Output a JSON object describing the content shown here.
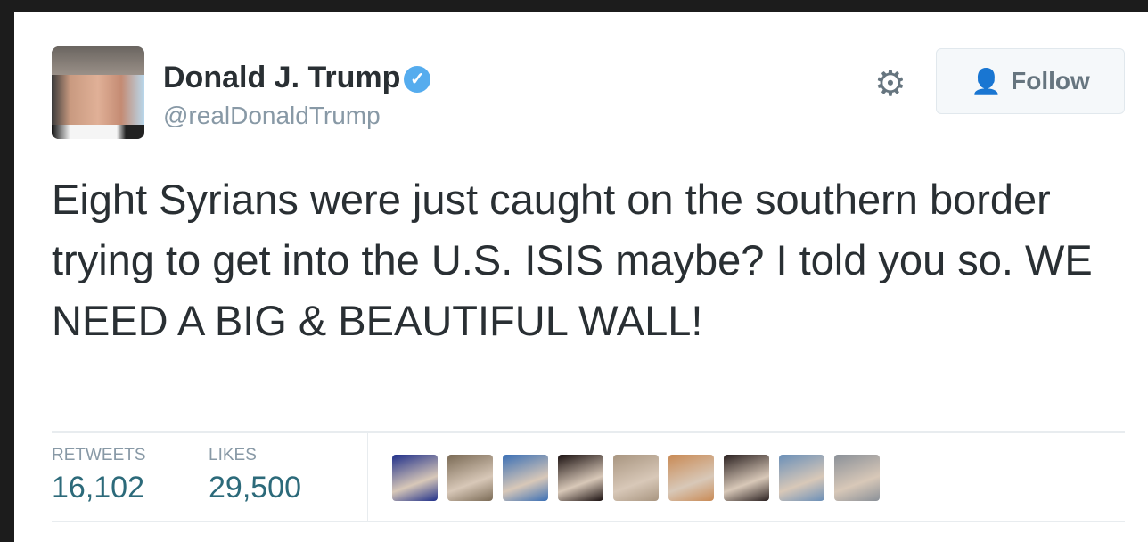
{
  "tweet": {
    "author_name": "Donald J. Trump",
    "handle": "@realDonaldTrump",
    "verified_icon": "verified-badge-icon",
    "follow_label": "Follow",
    "text": "Eight Syrians were just caught on the southern border trying to get into the U.S. ISIS maybe? I told you so. WE NEED A BIG & BEAUTIFUL WALL!",
    "stats": [
      {
        "label": "RETWEETS",
        "value": "16,102"
      },
      {
        "label": "LIKES",
        "value": "29,500"
      }
    ],
    "liker_avatar_colors": [
      "#1f2f8a",
      "#7a6a55",
      "#3a6fb5",
      "#1a1010",
      "#a89580",
      "#c98a55",
      "#2a2020",
      "#6a8fb8",
      "#8a9098"
    ]
  },
  "colors": {
    "accent": "#55acee",
    "stat_value": "#2c6a7a",
    "text": "#292f33",
    "muted": "#8899a6"
  }
}
